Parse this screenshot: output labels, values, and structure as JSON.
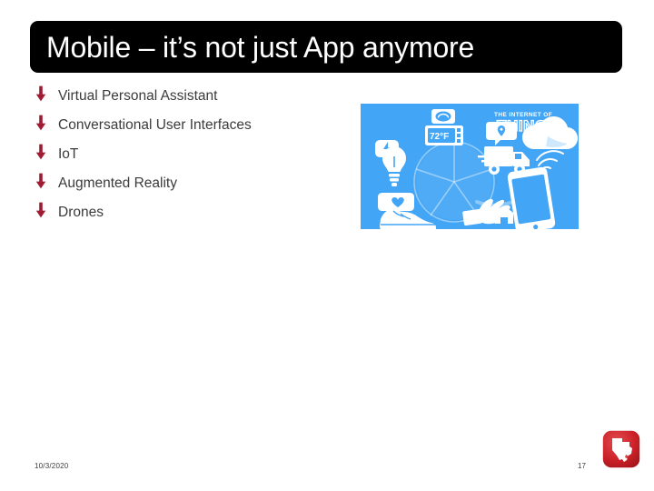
{
  "slide": {
    "title": "Mobile – it’s not just App anymore",
    "title_background": "#000000",
    "title_color": "#ffffff",
    "background": "#ffffff"
  },
  "bullets": {
    "marker_icon": "down-arrow-icon",
    "marker_color": "#9e1b32",
    "items": [
      {
        "label": "Virtual Personal Assistant"
      },
      {
        "label": "Conversational User Interfaces"
      },
      {
        "label": "IoT"
      },
      {
        "label": "Augmented Reality"
      },
      {
        "label": "Drones"
      }
    ]
  },
  "illustration": {
    "name": "internet-of-things-infographic",
    "background": "#42a5f5",
    "foreground": "#ffffff",
    "heading_small": "THE INTERNET OF",
    "heading_large": "THINGS",
    "thermostat_reading": "72°F",
    "icons": [
      "thermostat-icon",
      "lightbulb-icon",
      "plug-icon",
      "delivery-truck-icon",
      "location-pin-icon",
      "cloud-icon",
      "wifi-icon",
      "smartphone-icon",
      "sneaker-icon",
      "heart-rate-icon",
      "hand-icon",
      "home-icon",
      "wheel-diagram"
    ]
  },
  "footer": {
    "date": "10/3/2020",
    "page_number": "17",
    "logo_name": "texas-state-logo",
    "logo_color": "#cc2229",
    "logo_shape_color": "#ffffff"
  }
}
